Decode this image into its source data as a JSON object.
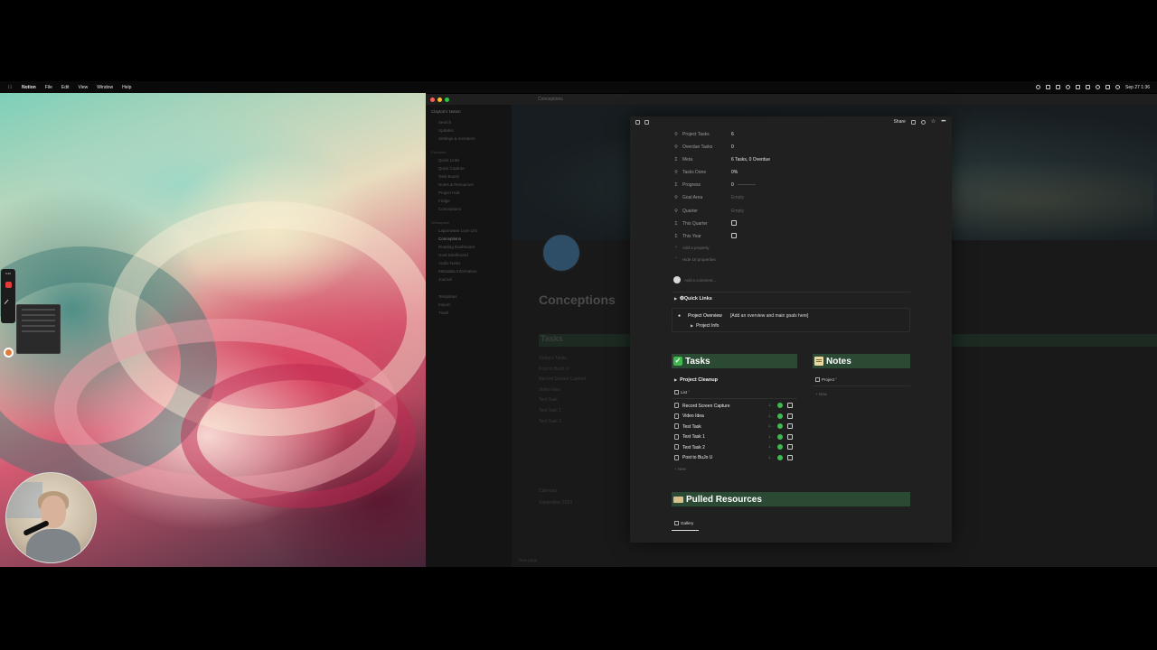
{
  "menubar": {
    "app": "Notion",
    "items": [
      "File",
      "Edit",
      "View",
      "Window",
      "Help"
    ],
    "clock": "Sep 27  1:36"
  },
  "recorder": {
    "label": "5:45"
  },
  "notion_bg": {
    "breadcrumb": "Conceptions",
    "workspace": "Clayton's Notion",
    "sidebar_items": [
      "Search",
      "Updates",
      "Settings & members"
    ],
    "favorites_header": "Favorites",
    "favorite_items": [
      "Quick Links",
      "Quick Capture",
      "Task Board",
      "Notes & Resources",
      "Project Hub",
      "Fridge",
      "Conceptions"
    ],
    "workspace_header": "Workspace",
    "workspace_items": [
      "Lagomwear Love List",
      "Conceptions",
      "Reading Dashboard",
      "Goal Dashboard",
      "Audio Notes",
      "Metadata Information",
      "Journal"
    ],
    "bottom_items": [
      "Templates",
      "Import",
      "Trash"
    ],
    "page_title": "Conceptions",
    "tasks_heading": "Tasks",
    "today_label": "Today's Tasks",
    "list": [
      "Post to BuJo U",
      "Record Screen Capture",
      "Video Idea",
      "Test Task",
      "Test Task 1",
      "Test Task 2"
    ],
    "calendar_tab": "Calendar",
    "calendar_month": "September 2023",
    "footer": "New page"
  },
  "peek": {
    "share_label": "Share",
    "properties": [
      {
        "icon": "search",
        "name": "Project Tasks",
        "value": "6"
      },
      {
        "icon": "search",
        "name": "Overdue Tasks",
        "value": "0"
      },
      {
        "icon": "sigma",
        "name": "Meta",
        "value": "6 Tasks, 0 Overdue"
      },
      {
        "icon": "search",
        "name": "Tasks Done",
        "value": "0%"
      },
      {
        "icon": "sigma",
        "name": "Progress",
        "value": "0"
      },
      {
        "icon": "search",
        "name": "Goal Area",
        "value": "Empty"
      },
      {
        "icon": "search",
        "name": "Quarter",
        "value": "Empty"
      },
      {
        "icon": "sigma",
        "name": "This Quarter",
        "value": ""
      },
      {
        "icon": "sigma",
        "name": "This Year",
        "value": ""
      }
    ],
    "add_property": "Add a property",
    "hide_properties": "Hide 16 properties",
    "comment_placeholder": "Add a comment...",
    "quick_links": "Quick Links",
    "callout": {
      "title": "Project Overview",
      "text": "[Add an overview and main goals here]",
      "toggle": "Project Info"
    },
    "tasks": {
      "heading": "Tasks",
      "group": "Project Cleanup",
      "view": "List",
      "rows": [
        {
          "name": "Record Screen Capture",
          "trunc": "1..."
        },
        {
          "name": "Video Idea",
          "trunc": "1..."
        },
        {
          "name": "Test Task",
          "trunc": "1..."
        },
        {
          "name": "Test Task 1",
          "trunc": "1..."
        },
        {
          "name": "Test Task 2",
          "trunc": "1..."
        },
        {
          "name": "Post to BuJo U",
          "trunc": "1..."
        }
      ],
      "new_label": "New"
    },
    "notes": {
      "heading": "Notes",
      "view": "Project",
      "new_label": "New"
    },
    "pulled": {
      "heading": "Pulled Resources",
      "view": "Gallery"
    }
  },
  "colors": {
    "callout_green": "#2b4a33",
    "status_green": "#3fb950",
    "peek_bg": "#202020"
  }
}
